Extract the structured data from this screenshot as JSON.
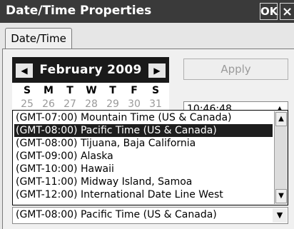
{
  "window": {
    "title": "Date/Time Properties",
    "ok_label": "OK",
    "close_label": "×"
  },
  "tabs": [
    {
      "label": "Date/Time",
      "active": true
    }
  ],
  "calendar": {
    "prev_label": "◀",
    "next_label": "▶",
    "month_year": "February 2009",
    "weekdays": [
      "S",
      "M",
      "T",
      "W",
      "T",
      "F",
      "S"
    ],
    "prev_month_days": [
      "25",
      "26",
      "27",
      "28",
      "29",
      "30",
      "31"
    ]
  },
  "apply_button": {
    "label": "Apply",
    "enabled": false
  },
  "time_field": {
    "value": "10:46:48"
  },
  "timezone": {
    "selected": "(GMT-08:00) Pacific Time (US & Canada)",
    "options": [
      "(GMT-07:00) Mountain Time (US & Canada)",
      "(GMT-08:00) Pacific Time (US & Canada)",
      "(GMT-08:00) Tijuana, Baja California",
      "(GMT-09:00) Alaska",
      "(GMT-10:00) Hawaii",
      "(GMT-11:00) Midway Island, Samoa",
      "(GMT-12:00) International Date Line West"
    ],
    "highlighted_index": 1,
    "scroll_up_icon": "▲",
    "scroll_down_icon": "▼",
    "combo_arrow_icon": "▼"
  },
  "colors": {
    "title_bar": "#3a3a3a",
    "selection": "#1e1e1e",
    "calendar_header": "#1a1a1a"
  }
}
